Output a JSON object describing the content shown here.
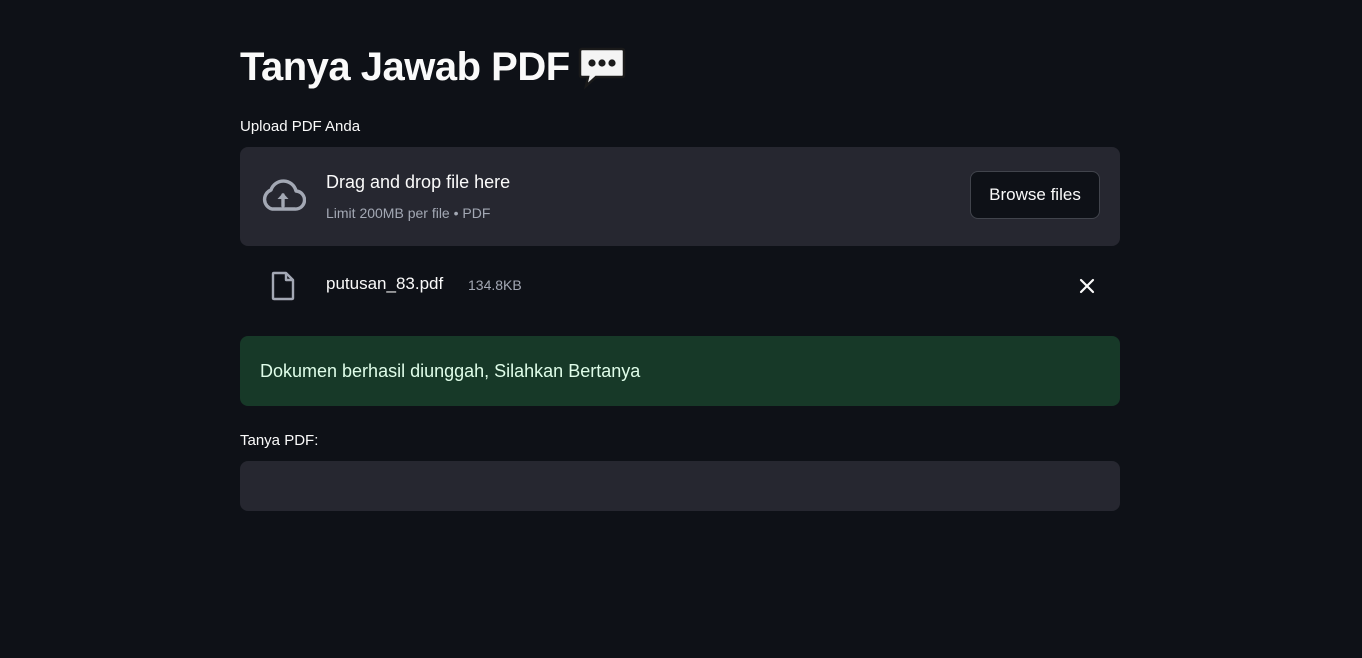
{
  "page": {
    "title": "Tanya Jawab PDF",
    "title_icon": "speech-balloon-icon"
  },
  "uploader": {
    "label": "Upload PDF Anda",
    "drop_text": "Drag and drop file here",
    "limit_text": "Limit 200MB per file • PDF",
    "browse_label": "Browse files",
    "icon": "cloud-upload-icon"
  },
  "uploaded_file": {
    "name": "putusan_83.pdf",
    "size": "134.8KB",
    "icon": "file-icon",
    "remove_icon": "close-icon"
  },
  "alert": {
    "message": "Dokumen berhasil diunggah, Silahkan Bertanya",
    "type": "success"
  },
  "question": {
    "label": "Tanya PDF:",
    "value": ""
  },
  "colors": {
    "background": "#0e1117",
    "panel": "#262730",
    "success_bg": "#173928",
    "success_text": "#dffde9",
    "muted_text": "#a3a8b4"
  }
}
